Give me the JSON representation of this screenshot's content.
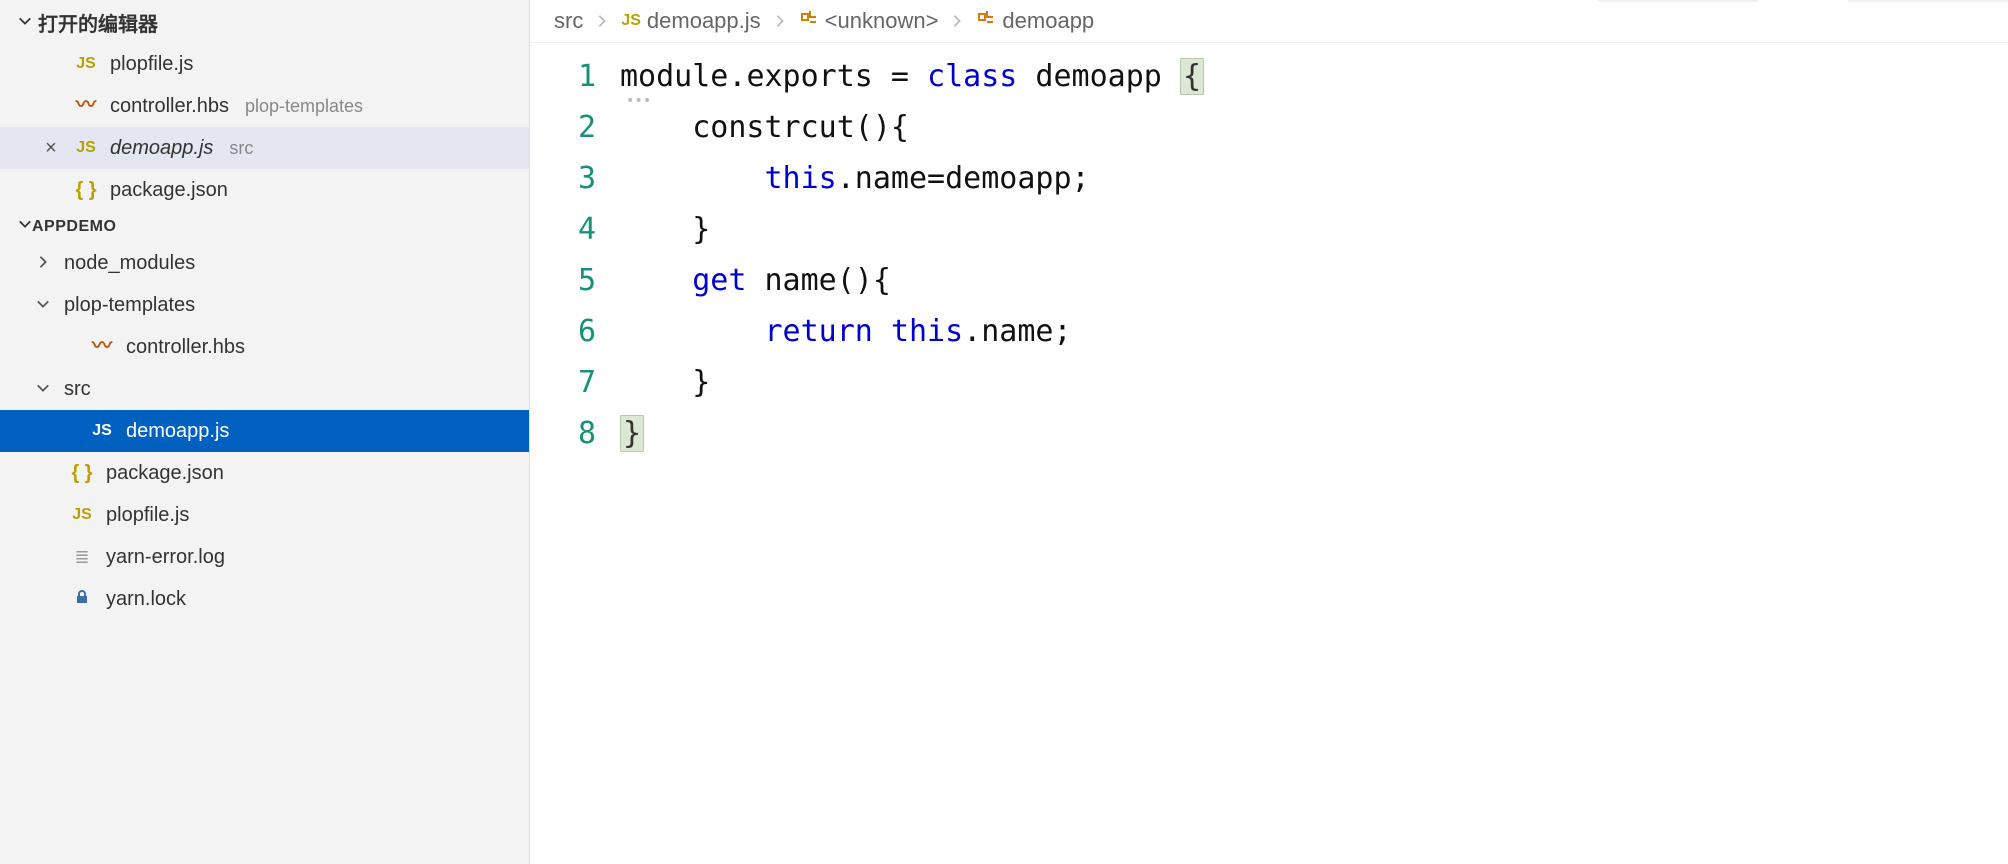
{
  "sidebar": {
    "openEditorsTitle": "打开的编辑器",
    "openEditors": [
      {
        "name": "plopfile.js",
        "icon": "js",
        "close": ""
      },
      {
        "name": "controller.hbs",
        "icon": "hbs",
        "hint": "plop-templates",
        "close": ""
      },
      {
        "name": "demoapp.js",
        "icon": "js",
        "hint": "src",
        "close": "×",
        "active": true,
        "italic": true
      },
      {
        "name": "package.json",
        "icon": "json",
        "close": ""
      }
    ],
    "projectTitle": "APPDEMO",
    "tree": [
      {
        "label": "node_modules",
        "chev": "right",
        "indent": 0
      },
      {
        "label": "plop-templates",
        "chev": "down",
        "indent": 0
      },
      {
        "label": "controller.hbs",
        "icon": "hbs",
        "indent": 1
      },
      {
        "label": "src",
        "chev": "down",
        "indent": 0
      },
      {
        "label": "demoapp.js",
        "icon": "js",
        "indent": 1,
        "selected": true
      },
      {
        "label": "package.json",
        "icon": "json",
        "indent": 0
      },
      {
        "label": "plopfile.js",
        "icon": "js",
        "indent": 0
      },
      {
        "label": "yarn-error.log",
        "icon": "log",
        "indent": 0
      },
      {
        "label": "yarn.lock",
        "icon": "lock",
        "indent": 0
      }
    ]
  },
  "breadcrumb": {
    "parts": [
      {
        "label": "src"
      },
      {
        "label": "demoapp.js",
        "icon": "js"
      },
      {
        "label": "<unknown>",
        "icon": "class"
      },
      {
        "label": "demoapp",
        "icon": "class"
      }
    ]
  },
  "code": {
    "lines": [
      [
        {
          "t": "module",
          "c": "id"
        },
        {
          "t": ".",
          "c": "id"
        },
        {
          "t": "exports",
          "c": "id"
        },
        {
          "t": " = ",
          "c": "id"
        },
        {
          "t": "class",
          "c": "kw"
        },
        {
          "t": " demoapp ",
          "c": "id"
        },
        {
          "t": "{",
          "c": "bracehl"
        }
      ],
      [
        {
          "t": "    ",
          "c": "id"
        },
        {
          "t": "constrcut(){",
          "c": "id"
        }
      ],
      [
        {
          "t": "        ",
          "c": "id"
        },
        {
          "t": "this",
          "c": "kw"
        },
        {
          "t": ".name=demoapp;",
          "c": "id"
        }
      ],
      [
        {
          "t": "    }",
          "c": "id"
        }
      ],
      [
        {
          "t": "    ",
          "c": "id"
        },
        {
          "t": "get",
          "c": "kw"
        },
        {
          "t": " name(){",
          "c": "id"
        }
      ],
      [
        {
          "t": "        ",
          "c": "id"
        },
        {
          "t": "return",
          "c": "kw"
        },
        {
          "t": " ",
          "c": "id"
        },
        {
          "t": "this",
          "c": "kw"
        },
        {
          "t": ".name;",
          "c": "id"
        }
      ],
      [
        {
          "t": "    }",
          "c": "id"
        }
      ],
      [
        {
          "t": "}",
          "c": "bracehl"
        }
      ]
    ]
  },
  "icons": {
    "js": "JS",
    "json": "{ }",
    "hbs": "〰",
    "log": "≣",
    "lock": "🔒",
    "class": "⌘"
  }
}
